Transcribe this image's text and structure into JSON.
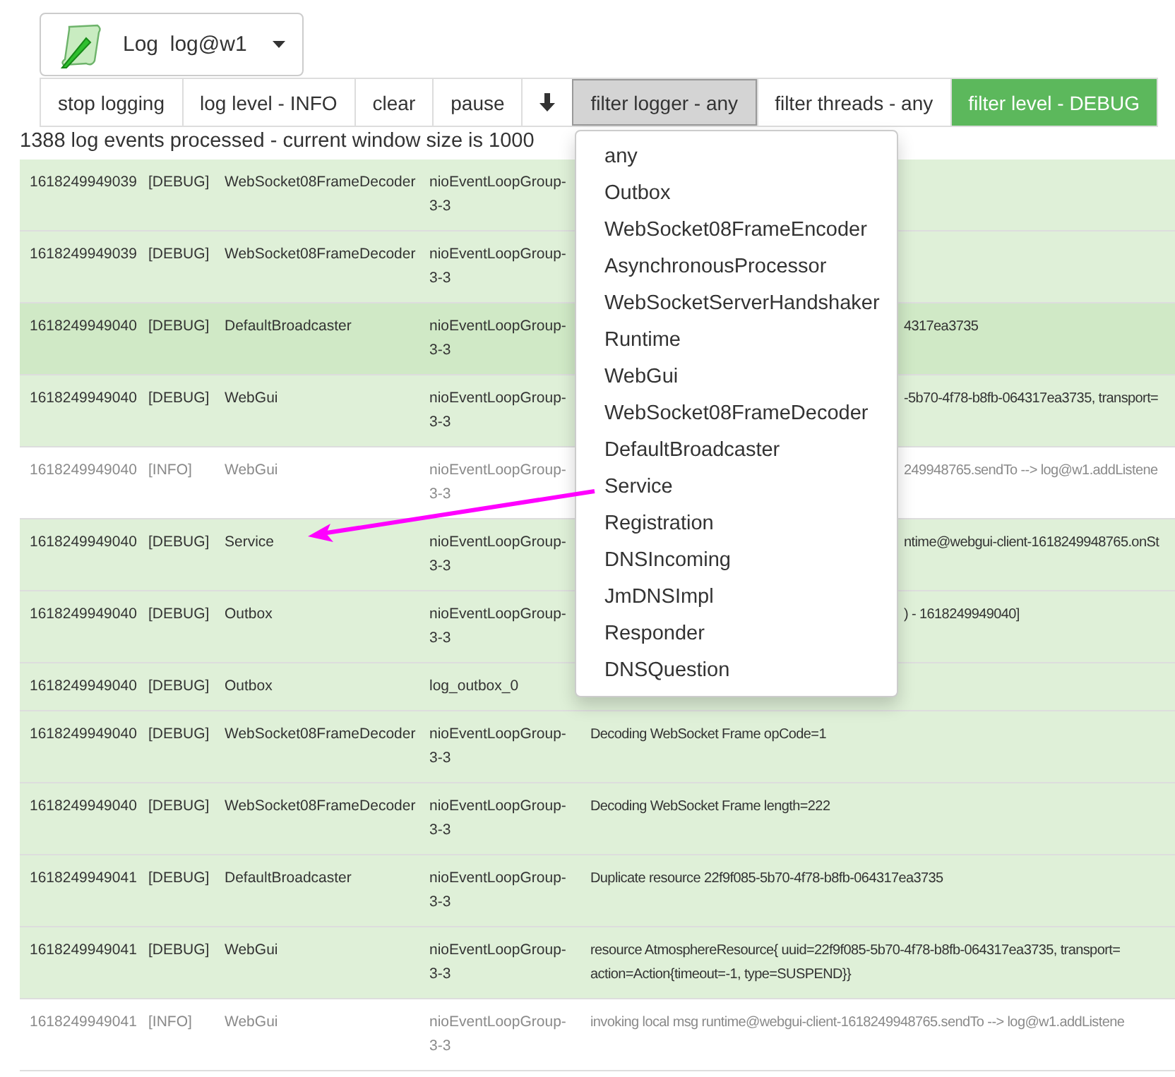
{
  "header": {
    "title": "Log",
    "instance": "log@w1"
  },
  "toolbar": [
    {
      "kind": "text",
      "label": "stop logging",
      "pressed": false
    },
    {
      "kind": "text",
      "label": "log level - INFO",
      "pressed": false
    },
    {
      "kind": "text",
      "label": "clear",
      "pressed": false
    },
    {
      "kind": "text",
      "label": "pause",
      "pressed": false
    },
    {
      "kind": "icon",
      "pressed": false
    },
    {
      "kind": "text",
      "label": "filter logger - any",
      "pressed": true
    },
    {
      "kind": "text",
      "label": "filter threads - any",
      "pressed": false
    },
    {
      "kind": "success",
      "label": "filter level - DEBUG",
      "pressed": false
    }
  ],
  "status": "1388 log events processed - current window size is 1000",
  "rows": [
    {
      "time": "1618249949039",
      "level": "[DEBUG]",
      "logger": "WebSocket08FrameDecoder",
      "thread": "nioEventLoopGroup-3-3",
      "kind": "debug",
      "hovered": false
    },
    {
      "time": "1618249949039",
      "level": "[DEBUG]",
      "logger": "WebSocket08FrameDecoder",
      "thread": "nioEventLoopGroup-3-3",
      "kind": "debug",
      "hovered": false
    },
    {
      "time": "1618249949040",
      "level": "[DEBUG]",
      "logger": "DefaultBroadcaster",
      "thread": "nioEventLoopGroup-3-3",
      "kind": "debug",
      "hovered": true,
      "under_menu": true,
      "message_lines": [
        "4317ea3735"
      ]
    },
    {
      "time": "1618249949040",
      "level": "[DEBUG]",
      "logger": "WebGui",
      "thread": "nioEventLoopGroup-3-3",
      "kind": "debug",
      "hovered": false,
      "under_menu": true,
      "message_lines": [
        "-5b70-4f78-b8fb-064317ea3735, transport="
      ]
    },
    {
      "time": "1618249949040",
      "level": "[INFO]",
      "logger": "WebGui",
      "thread": "nioEventLoopGroup-3-3",
      "kind": "info",
      "hovered": false,
      "under_menu": true,
      "message_lines": [
        "249948765.sendTo --> log@w1.addListene"
      ]
    },
    {
      "time": "1618249949040",
      "level": "[DEBUG]",
      "logger": "Service",
      "thread": "nioEventLoopGroup-3-3",
      "kind": "debug",
      "hovered": false,
      "under_menu": true,
      "message_lines": [
        "ntime@webgui-client-1618249948765.onSt"
      ]
    },
    {
      "time": "1618249949040",
      "level": "[DEBUG]",
      "logger": "Outbox",
      "thread": "nioEventLoopGroup-3-3",
      "kind": "debug",
      "hovered": false,
      "under_menu": true,
      "message_lines": [
        ") - 1618249949040]"
      ]
    },
    {
      "time": "1618249949040",
      "level": "[DEBUG]",
      "logger": "Outbox",
      "thread": "log_outbox_0",
      "kind": "debug",
      "hovered": false
    },
    {
      "time": "1618249949040",
      "level": "[DEBUG]",
      "logger": "WebSocket08FrameDecoder",
      "thread": "nioEventLoopGroup-3-3",
      "kind": "debug",
      "hovered": false,
      "message_lines": [
        "Decoding WebSocket Frame opCode=1"
      ]
    },
    {
      "time": "1618249949040",
      "level": "[DEBUG]",
      "logger": "WebSocket08FrameDecoder",
      "thread": "nioEventLoopGroup-3-3",
      "kind": "debug",
      "hovered": false,
      "message_lines": [
        "Decoding WebSocket Frame length=222"
      ]
    },
    {
      "time": "1618249949041",
      "level": "[DEBUG]",
      "logger": "DefaultBroadcaster",
      "thread": "nioEventLoopGroup-3-3",
      "kind": "debug",
      "hovered": false,
      "message_lines": [
        "Duplicate resource 22f9f085-5b70-4f78-b8fb-064317ea3735"
      ]
    },
    {
      "time": "1618249949041",
      "level": "[DEBUG]",
      "logger": "WebGui",
      "thread": "nioEventLoopGroup-3-3",
      "kind": "debug",
      "hovered": false,
      "message_lines": [
        "resource AtmosphereResource{ uuid=22f9f085-5b70-4f78-b8fb-064317ea3735, transport=",
        "action=Action{timeout=-1, type=SUSPEND}}"
      ]
    },
    {
      "time": "1618249949041",
      "level": "[INFO]",
      "logger": "WebGui",
      "thread": "nioEventLoopGroup-3-3",
      "kind": "info",
      "hovered": false,
      "message_lines": [
        "invoking local msg runtime@webgui-client-1618249948765.sendTo --> log@w1.addListene"
      ]
    }
  ],
  "menu": {
    "items": [
      "any",
      "Outbox",
      "WebSocket08FrameEncoder",
      "AsynchronousProcessor",
      "WebSocketServerHandshaker",
      "Runtime",
      "WebGui",
      "WebSocket08FrameDecoder",
      "DefaultBroadcaster",
      "Service",
      "Registration",
      "DNSIncoming",
      "JmDNSImpl",
      "Responder",
      "DNSQuestion"
    ]
  }
}
